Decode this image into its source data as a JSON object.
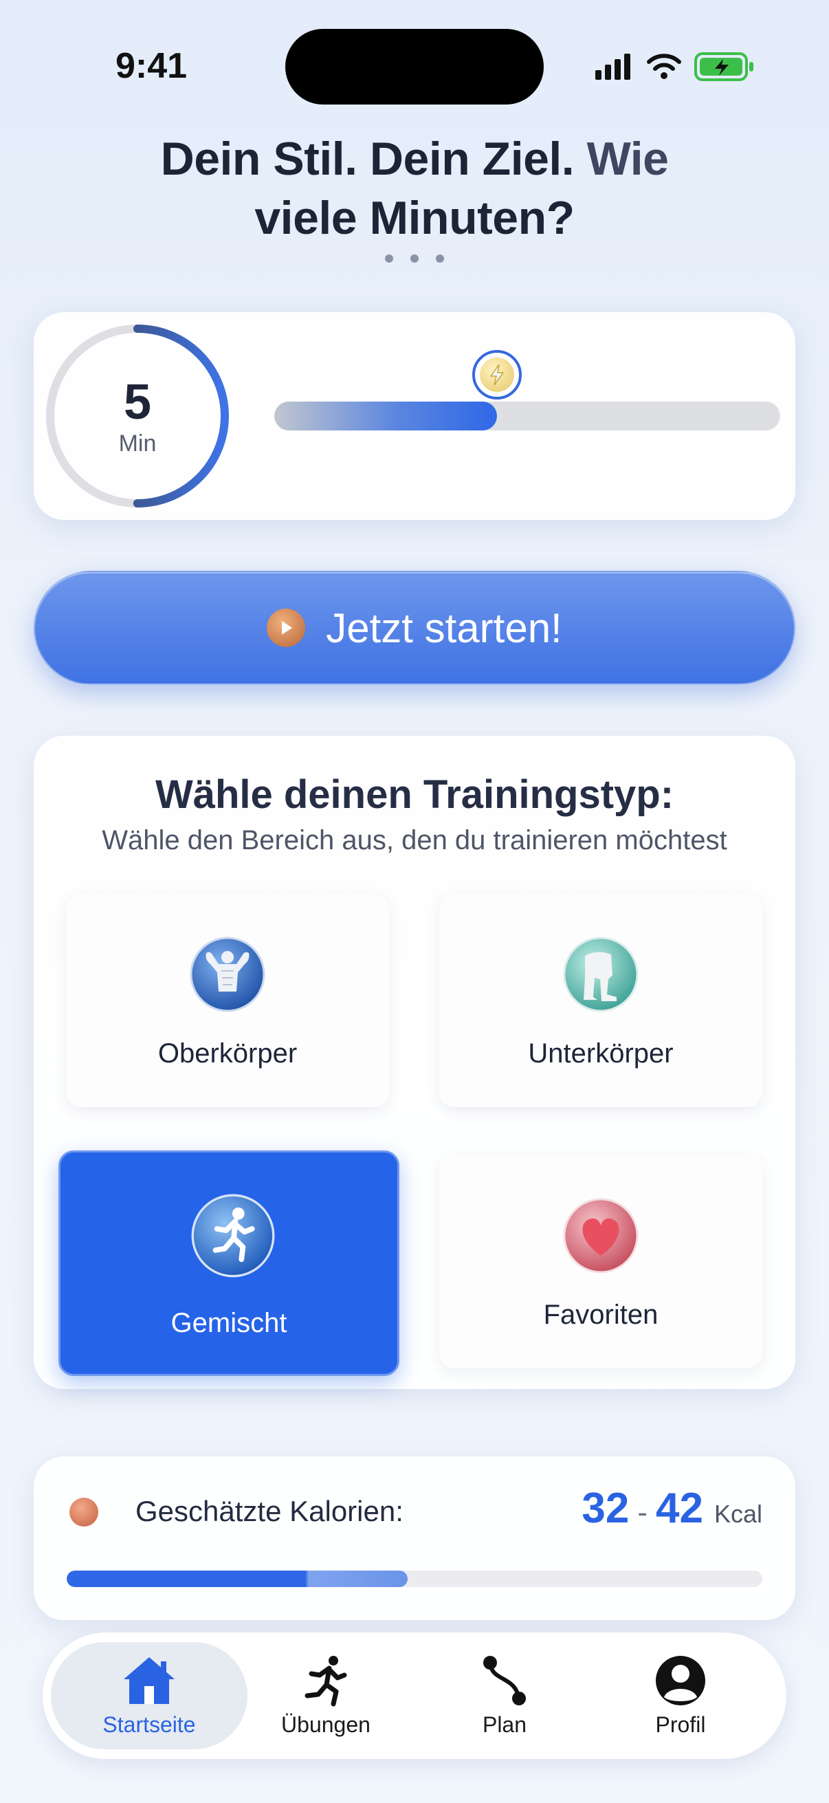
{
  "status_bar": {
    "time": "9:41"
  },
  "headline": {
    "part1": "Dein Stil. Dein Ziel.",
    "part2": "Wie",
    "part3": "viele Minuten?"
  },
  "duration": {
    "value": "5",
    "unit": "Min",
    "slider_level_percent": 44,
    "ring_level_percent": 50
  },
  "start_button": {
    "label": "Jetzt starten!"
  },
  "training": {
    "title": "Wähle deinen Trainingstyp:",
    "subtitle": "Wähle den Bereich aus, den du trainieren möchtest",
    "options": [
      {
        "label": "Oberkörper",
        "icon": "flexed-torso-icon",
        "selected": false
      },
      {
        "label": "Unterkörper",
        "icon": "legs-icon",
        "selected": false
      },
      {
        "label": "Gemischt",
        "icon": "running-person-icon",
        "selected": true
      },
      {
        "label": "Favoriten",
        "icon": "heart-icon",
        "selected": false
      }
    ]
  },
  "calories": {
    "label": "Geschätzte Kalorien:",
    "min": "32",
    "separator": "-",
    "max": "42",
    "unit": "Kcal",
    "level_percent": 49
  },
  "tabbar": {
    "tabs": [
      {
        "label": "Startseite",
        "icon": "home-icon",
        "active": true
      },
      {
        "label": "Übungen",
        "icon": "running-icon",
        "active": false
      },
      {
        "label": "Plan",
        "icon": "route-icon",
        "active": false
      },
      {
        "label": "Profil",
        "icon": "profile-icon",
        "active": false
      }
    ]
  },
  "colors": {
    "accent": "#2563e8",
    "text_dark": "#1e2538",
    "muted": "#4e5566"
  }
}
